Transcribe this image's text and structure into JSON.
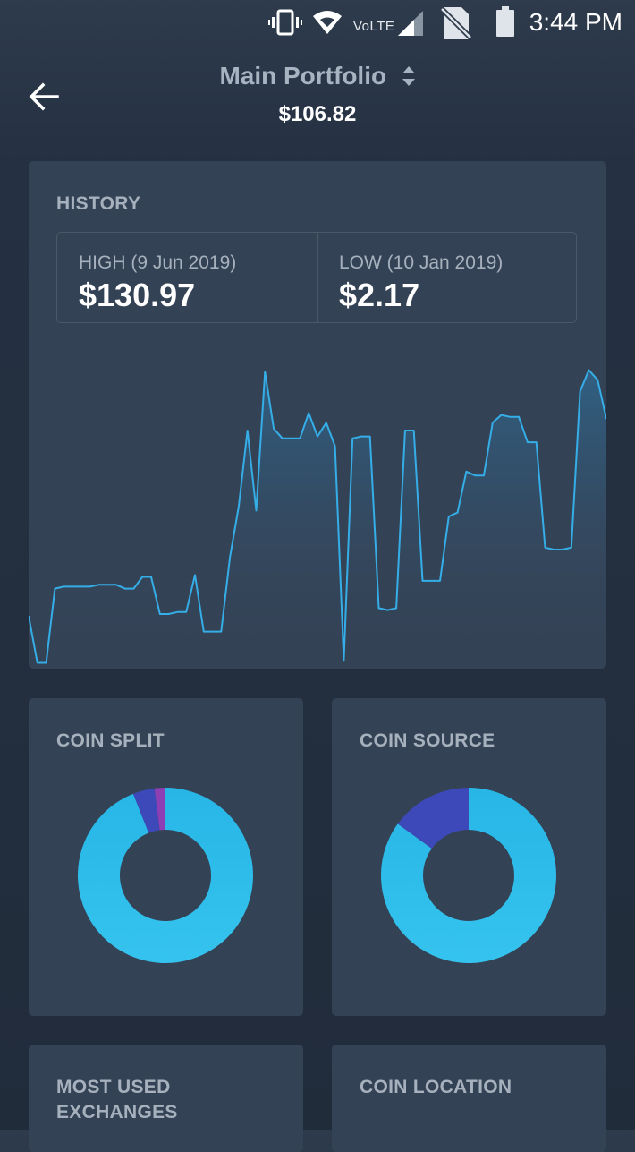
{
  "status_bar": {
    "time": "3:44 PM",
    "network": "VoLTE",
    "icons": [
      "vibrate-icon",
      "wifi-icon",
      "signal-icon",
      "no-sim-icon",
      "battery-icon"
    ]
  },
  "header": {
    "title": "Main Portfolio",
    "value": "$106.82",
    "back_icon": "arrow-left-icon",
    "sort_icon": "sort-up-down-icon"
  },
  "history": {
    "title": "HISTORY",
    "high_label": "HIGH (9 Jun 2019)",
    "high_value": "$130.97",
    "low_label": "LOW (10 Jan 2019)",
    "low_value": "$2.17"
  },
  "coin_split": {
    "title": "COIN SPLIT"
  },
  "coin_source": {
    "title": "COIN SOURCE"
  },
  "most_used_exchanges": {
    "title_line1": "MOST USED",
    "title_line2": "EXCHANGES"
  },
  "coin_location": {
    "title": "COIN LOCATION"
  },
  "colors": {
    "background": "#212c3b",
    "card": "#344255",
    "line": "#35aee8",
    "donut_main": "#2cb9e8",
    "donut_indigo": "#3d49b8",
    "donut_purple": "#8e3fb3",
    "muted_text": "#a6b1bd"
  },
  "chart_data": [
    {
      "type": "area",
      "title": "HISTORY",
      "xlabel": "",
      "ylabel": "",
      "axes_visible": false,
      "grid": false,
      "ylim": [
        0,
        150
      ],
      "values": [
        27,
        3,
        3,
        41,
        42,
        42,
        42,
        42,
        43,
        43,
        43,
        41,
        41,
        47,
        47,
        28,
        28,
        29,
        29,
        48,
        19,
        19,
        19,
        57,
        83,
        122,
        81,
        152,
        123,
        118,
        118,
        118,
        131,
        119,
        126,
        114,
        4,
        118,
        119,
        119,
        31,
        30,
        31,
        122,
        122,
        45,
        45,
        45,
        78,
        80,
        101,
        99,
        99,
        126,
        130,
        129,
        129,
        116,
        116,
        62,
        61,
        61,
        62,
        142,
        153,
        148,
        128
      ]
    },
    {
      "type": "pie",
      "title": "COIN SPLIT",
      "donut": true,
      "values": [
        94,
        4,
        2
      ]
    },
    {
      "type": "pie",
      "title": "COIN SOURCE",
      "donut": true,
      "values": [
        85,
        15
      ]
    }
  ]
}
